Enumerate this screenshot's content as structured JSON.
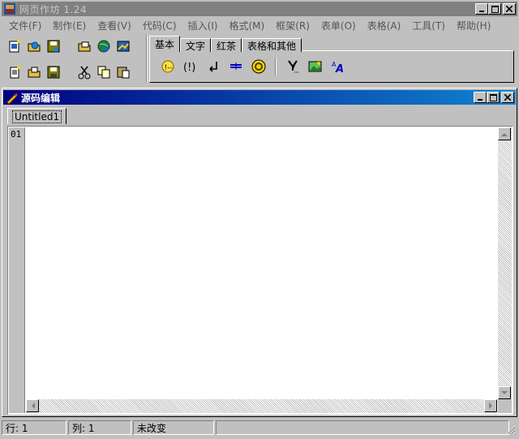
{
  "app": {
    "title": "网页作坊 1.24",
    "minimize_label": "_",
    "maximize_label": "□",
    "close_label": "×"
  },
  "menu": [
    "文件(F)",
    "制作(E)",
    "查看(V)",
    "代码(C)",
    "插入(I)",
    "格式(M)",
    "框架(R)",
    "表单(O)",
    "表格(A)",
    "工具(T)",
    "帮助(H)"
  ],
  "toolbar": {
    "row1_icons": [
      "new-page-icon",
      "open-folder-icon",
      "save-icon",
      "open-web-icon",
      "browser-preview-icon",
      "publish-icon"
    ],
    "row2_icons": [
      "new-file-icon",
      "open-file-icon",
      "save-disk-icon",
      "cut-icon",
      "copy-icon",
      "paste-icon"
    ]
  },
  "insert_tabs": {
    "tabs": [
      "基本",
      "文字",
      "红茶",
      "表格和其他"
    ],
    "active": "基本",
    "icons": [
      "comment-icon",
      "script-tag-icon",
      "line-break-icon",
      "horizontal-rule-icon",
      "anchor-icon",
      "special-char-icon",
      "image-icon",
      "font-icon"
    ]
  },
  "editor": {
    "title": "源码编辑",
    "document_tab": "Untitled1",
    "line_number": "01",
    "content": ""
  },
  "status": {
    "row": "行: 1",
    "col": "列: 1",
    "modified": "未改变",
    "extra": ""
  },
  "colors": {
    "face": "#c0c0c0",
    "active_title_start": "#000080",
    "active_title_end": "#1084d0",
    "inactive_title": "#808080"
  }
}
